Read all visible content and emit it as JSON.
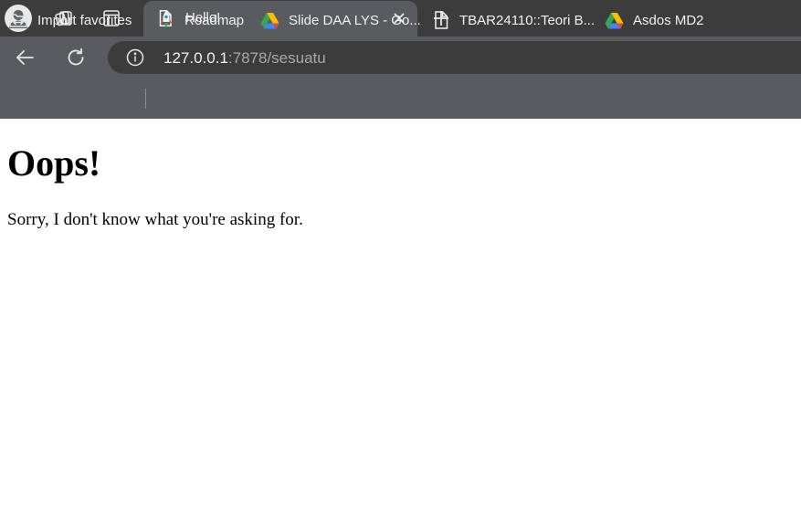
{
  "tabs": [
    {
      "title": "Hello!",
      "active": true
    }
  ],
  "address_bar": {
    "url_host": "127.0.0.1",
    "url_rest": ":7878/sesuatu"
  },
  "bookmarks": [
    {
      "label": "Import favorites",
      "icon": "import-favorites-icon"
    },
    {
      "label": "Roadmap",
      "icon": "rocket-icon"
    },
    {
      "label": "Slide DAA LYS - Go...",
      "icon": "google-drive-icon"
    },
    {
      "label": "TBAR24110::Teori B...",
      "icon": "document-icon"
    },
    {
      "label": "Asdos MD2",
      "icon": "google-drive-icon"
    }
  ],
  "page": {
    "heading": "Oops!",
    "message": "Sorry, I don't know what you're asking for."
  },
  "colors": {
    "tab_strip": "#3c3c3c",
    "toolbar": "#5a5b5e",
    "omnibox": "#3c3c3c",
    "text_light": "#f1f1f1",
    "url_dim": "#a8a8a8",
    "page_background": "#ffffff"
  }
}
